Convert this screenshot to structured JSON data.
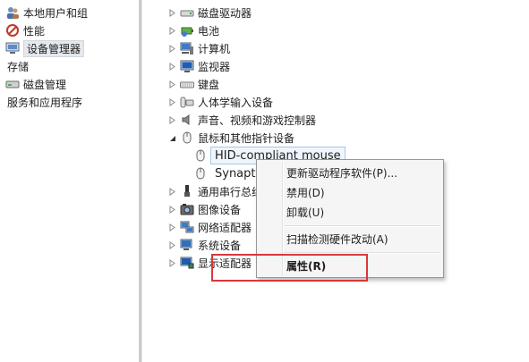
{
  "left_tree": {
    "items": [
      {
        "label": "本地用户和组"
      },
      {
        "label": "性能"
      },
      {
        "label": "设备管理器"
      },
      {
        "label": "存储"
      },
      {
        "label": "磁盘管理"
      },
      {
        "label": "服务和应用程序"
      }
    ]
  },
  "device_tree": {
    "items": [
      {
        "label": "磁盘驱动器"
      },
      {
        "label": "电池"
      },
      {
        "label": "计算机"
      },
      {
        "label": "监视器"
      },
      {
        "label": "键盘"
      },
      {
        "label": "人体学输入设备"
      },
      {
        "label": "声音、视频和游戏控制器"
      },
      {
        "label": "鼠标和其他指针设备"
      },
      {
        "label": "HID-compliant mouse"
      },
      {
        "label": "Synaptic"
      },
      {
        "label": "通用串行总线"
      },
      {
        "label": "图像设备"
      },
      {
        "label": "网络适配器"
      },
      {
        "label": "系统设备"
      },
      {
        "label": "显示适配器"
      }
    ]
  },
  "context_menu": {
    "update_driver": "更新驱动程序软件(P)...",
    "disable": "禁用(D)",
    "uninstall": "卸载(U)",
    "scan": "扫描检测硬件改动(A)",
    "properties": "属性(R)"
  },
  "colors": {
    "highlight": "#d9383a",
    "menu_bg": "#f5f5f5"
  }
}
